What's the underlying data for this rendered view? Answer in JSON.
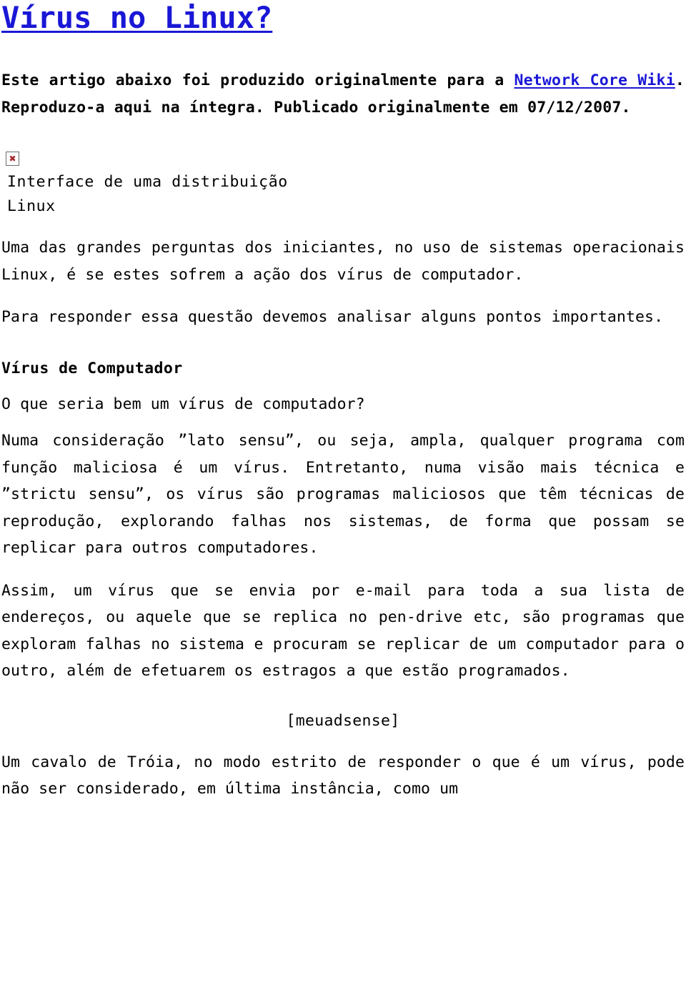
{
  "document": {
    "title": "Vírus no Linux?",
    "language": "pt-BR",
    "background_color": "#ffffff",
    "text_color": "#000000",
    "link_color": "#1a17d6"
  },
  "intro": {
    "text_before_link": "Este artigo abaixo foi produzido originalmente para a ",
    "link_label": "Network Core Wiki",
    "text_after_link": ". Reproduzo-a aqui na íntegra. Publicado originalmente em 07/12/2007.",
    "publication_date": "07/12/2007"
  },
  "figure": {
    "icon": "broken-image-icon",
    "alt_marker": "x",
    "caption": "Interface de uma distribuição Linux"
  },
  "sections": [
    {
      "id": "intro-paragraphs",
      "paragraphs": [
        "Uma das grandes perguntas dos iniciantes, no uso de sistemas operacionais Linux, é se estes sofrem a ação dos vírus de computador.",
        "Para responder essa questão devemos analisar alguns pontos importantes."
      ]
    },
    {
      "id": "virus-de-computador",
      "heading": "Vírus de Computador",
      "paragraphs": [
        "O que seria bem um vírus de computador?",
        "Numa consideração ”lato sensu”, ou seja, ampla, qualquer programa com função maliciosa é um vírus. Entretanto, numa visão mais técnica e ”strictu sensu”, os vírus são programas maliciosos que têm técnicas de reprodução, explorando falhas nos sistemas, de forma que possam se replicar para outros computadores.",
        "Assim, um vírus que se envia por e-mail para toda a sua lista de endereços, ou aquele que se replica no pen-drive etc, são programas que exploram falhas no sistema e procuram se replicar de um computador para o outro, além de efetuarem os estragos a que estão programados."
      ]
    }
  ],
  "ad_slot": {
    "label": "[meuadsense]"
  },
  "trailing": {
    "paragraph": "Um cavalo de Tróia, no modo estrito de responder o que é um vírus, pode não ser considerado, em última instância, como um"
  }
}
